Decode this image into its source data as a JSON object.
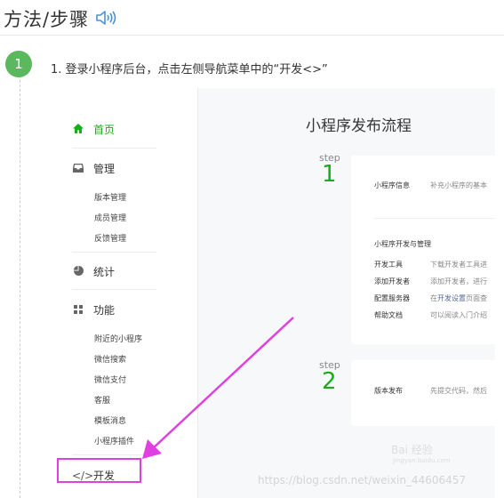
{
  "header": {
    "title": "方法/步骤",
    "sound_icon": "speaker-icon"
  },
  "step": {
    "number": "1",
    "text": "1. 登录小程序后台，点击左侧导航菜单中的“开发<>”"
  },
  "screenshot": {
    "sidebar": {
      "home": "首页",
      "management": "管理",
      "management_items": [
        "版本管理",
        "成员管理",
        "反馈管理"
      ],
      "stats": "统计",
      "features": "功能",
      "feature_items": [
        "附近的小程序",
        "微信搜索",
        "微信支付",
        "客服",
        "模板消息",
        "小程序插件"
      ],
      "develop": "开发"
    },
    "main": {
      "title": "小程序发布流程",
      "step_word": "step",
      "step1_num": "1",
      "step2_num": "2",
      "card1": {
        "info_label": "小程序信息",
        "info_value": "补充小程序的基本",
        "section_title": "小程序开发与管理",
        "rows": [
          {
            "label": "开发工具",
            "value": "下载开发者工具进"
          },
          {
            "label": "添加开发者",
            "value": "添加开发者，进行"
          },
          {
            "label": "配置服务器",
            "value_prefix": "在",
            "link": "开发设置",
            "value_suffix": "页面查"
          },
          {
            "label": "帮助文档",
            "value": "可以阅读入门介绍"
          }
        ]
      },
      "card2": {
        "label": "版本发布",
        "value": "先提交代码，然后"
      }
    }
  },
  "watermark": "https://blog.csdn.net/weixin_44606457",
  "baidu_watermark": "Bai 经验",
  "baidu_sub": "jingyan.baidu.com",
  "colors": {
    "accent_green": "#1aad19",
    "badge_green": "#5cb85c",
    "highlight": "#e040e0",
    "link": "#576b95"
  }
}
